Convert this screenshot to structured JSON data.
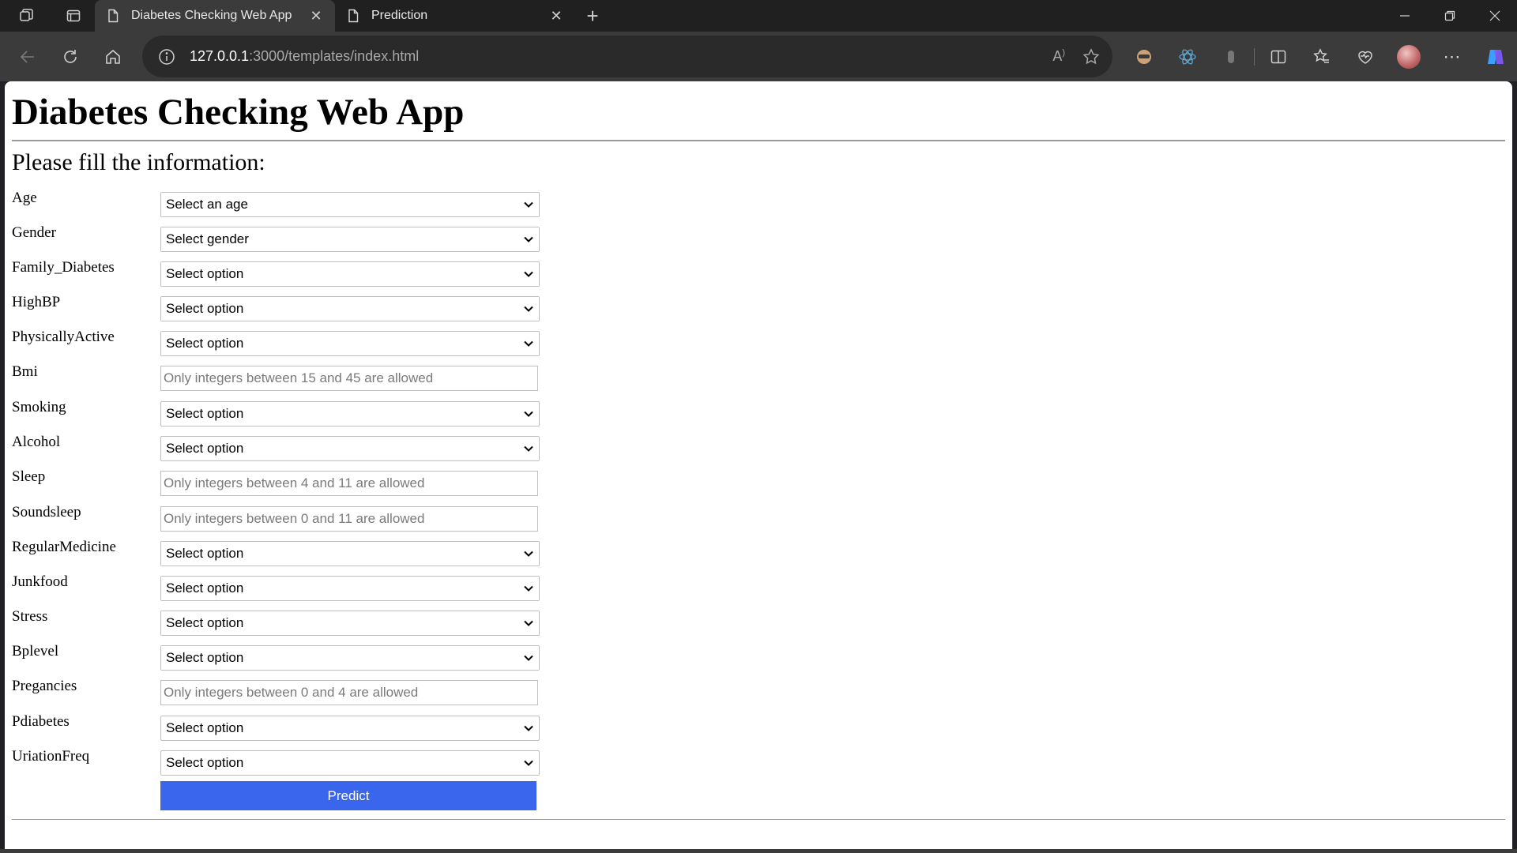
{
  "browser": {
    "tabs": [
      {
        "title": "Diabetes Checking Web App",
        "active": true
      },
      {
        "title": "Prediction",
        "active": false
      }
    ],
    "url_host": "127.0.0.1",
    "url_rest": ":3000/templates/index.html"
  },
  "page": {
    "title": "Diabetes Checking Web App",
    "subtitle": "Please fill the information:",
    "fields": [
      {
        "label": "Age",
        "type": "select",
        "value": "Select an age"
      },
      {
        "label": "Gender",
        "type": "select",
        "value": "Select gender"
      },
      {
        "label": "Family_Diabetes",
        "type": "select",
        "value": "Select option"
      },
      {
        "label": "HighBP",
        "type": "select",
        "value": "Select option"
      },
      {
        "label": "PhysicallyActive",
        "type": "select",
        "value": "Select option"
      },
      {
        "label": "Bmi",
        "type": "text",
        "placeholder": "Only integers between 15 and 45 are allowed"
      },
      {
        "label": "Smoking",
        "type": "select",
        "value": "Select option"
      },
      {
        "label": "Alcohol",
        "type": "select",
        "value": "Select option"
      },
      {
        "label": "Sleep",
        "type": "text",
        "placeholder": "Only integers between 4 and 11 are allowed"
      },
      {
        "label": "Soundsleep",
        "type": "text",
        "placeholder": "Only integers between 0 and 11 are allowed"
      },
      {
        "label": "RegularMedicine",
        "type": "select",
        "value": "Select option"
      },
      {
        "label": "Junkfood",
        "type": "select",
        "value": "Select option"
      },
      {
        "label": "Stress",
        "type": "select",
        "value": "Select option"
      },
      {
        "label": "Bplevel",
        "type": "select",
        "value": "Select option"
      },
      {
        "label": "Pregancies",
        "type": "text",
        "placeholder": "Only integers between 0 and 4 are allowed"
      },
      {
        "label": "Pdiabetes",
        "type": "select",
        "value": "Select option"
      },
      {
        "label": "UriationFreq",
        "type": "select",
        "value": "Select option"
      }
    ],
    "submit_label": "Predict"
  }
}
